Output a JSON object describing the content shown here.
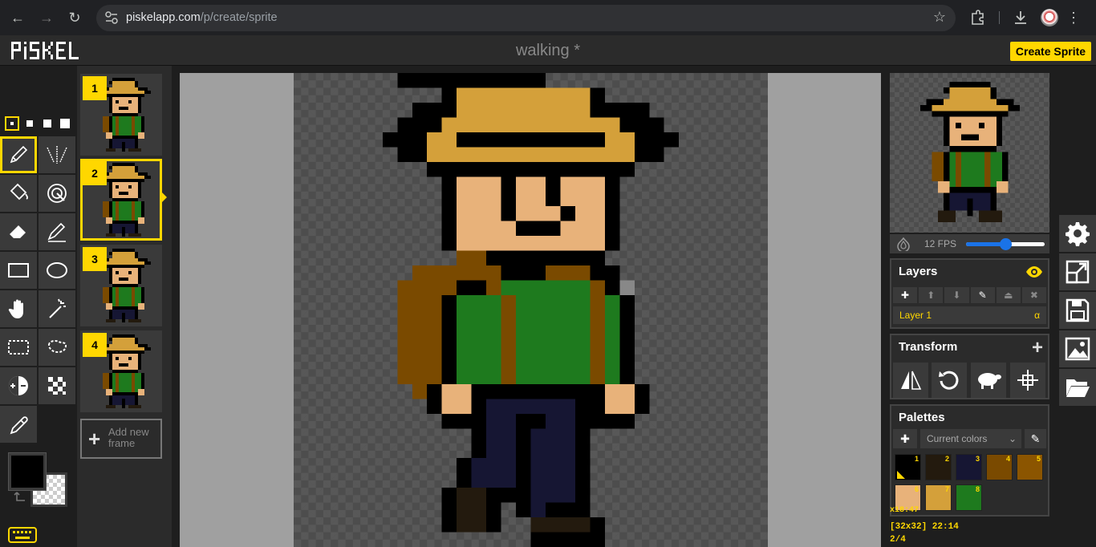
{
  "browser": {
    "url_host": "piskelapp.com",
    "url_path": "/p/create/sprite"
  },
  "app": {
    "logo": "PiSKEL",
    "doc_title": "walking *",
    "create_button": "Create Sprite"
  },
  "frames": [
    {
      "num": "1"
    },
    {
      "num": "2"
    },
    {
      "num": "3"
    },
    {
      "num": "4"
    }
  ],
  "add_frame_label_1": "Add new",
  "add_frame_label_2": "frame",
  "preview": {
    "fps_label": "12 FPS",
    "fps_fraction": 0.5
  },
  "layers": {
    "title": "Layers",
    "layer_name": "Layer 1",
    "alpha": "α"
  },
  "transform": {
    "title": "Transform"
  },
  "palettes": {
    "title": "Palettes",
    "selected": "Current colors",
    "colors": [
      {
        "n": "1",
        "c": "#000000"
      },
      {
        "n": "2",
        "c": "#231a0e"
      },
      {
        "n": "3",
        "c": "#161633"
      },
      {
        "n": "4",
        "c": "#7a4a00"
      },
      {
        "n": "5",
        "c": "#8b5500"
      },
      {
        "n": "6",
        "c": "#e8b27a"
      },
      {
        "n": "7",
        "c": "#d4a03a"
      },
      {
        "n": "8",
        "c": "#1e7a1e"
      }
    ]
  },
  "status": {
    "cursor": "x18:47",
    "size_time": "[32x32] 22:14",
    "frame_index": "2/4"
  },
  "colors": {
    "accent": "#ffd700",
    "primary": "#000000"
  }
}
